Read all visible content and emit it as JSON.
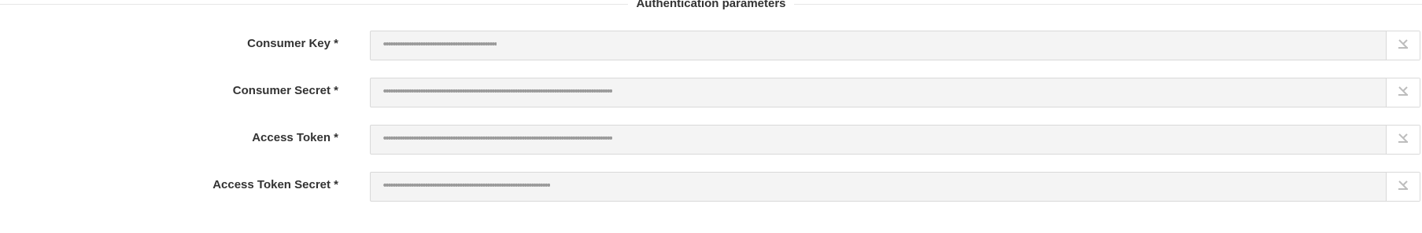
{
  "section": {
    "title": "Authentication parameters"
  },
  "fields": [
    {
      "label": "Consumer Key *",
      "value": "••••••••••••••••••••••••••••••••••••••••••••••••••"
    },
    {
      "label": "Consumer Secret *",
      "value": "••••••••••••••••••••••••••••••••••••••••••••••••••••••••••••••••••••••••••••••••••••••••••••••••••••"
    },
    {
      "label": "Access Token *",
      "value": "••••••••••••••••••••••••••••••••••••••••••••••••••••••••••••••••••••••••••••••••••••••••••••••••••••"
    },
    {
      "label": "Access Token Secret *",
      "value": "•••••••••••••••••••••••••••••••••••••••••••••••••••••••••••••••••••••••••"
    }
  ],
  "icons": {
    "reveal": "eye-toggle-icon"
  },
  "colors": {
    "field_background": "#f4f4f4",
    "field_border": "#d9d9d9",
    "label_text": "#333333",
    "masked_text": "#9a9a9a"
  }
}
